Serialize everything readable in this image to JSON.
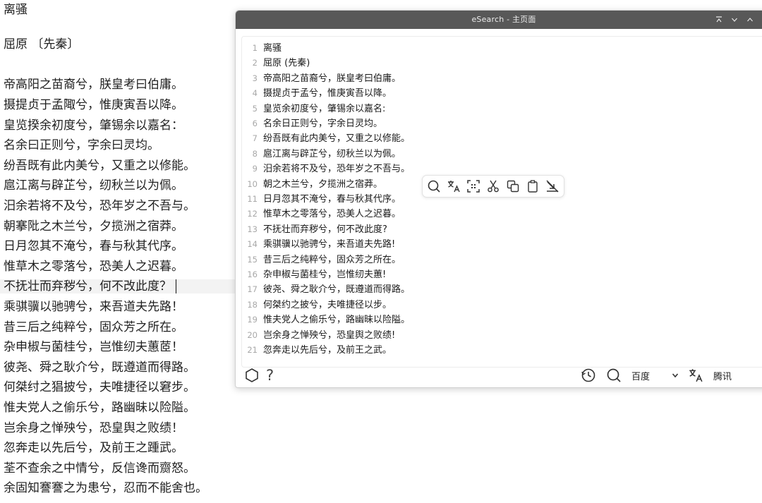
{
  "document": {
    "lines": [
      "离骚",
      "",
      "屈原 〔先秦〕",
      "",
      "帝高阳之苗裔兮，朕皇考曰伯庸。",
      "摄提贞于孟陬兮，惟庚寅吾以降。",
      "皇览揆余初度兮，肇锡余以嘉名：",
      "名余曰正则兮，字余曰灵均。",
      "纷吾既有此内美兮，又重之以修能。",
      "扈江离与辟芷兮，纫秋兰以为佩。",
      "汨余若将不及兮，恐年岁之不吾与。",
      "朝搴阰之木兰兮，夕揽洲之宿莽。",
      "日月忽其不淹兮，春与秋其代序。",
      "惟草木之零落兮，恐美人之迟暮。",
      "不抚壮而弃秽兮，何不改此度？",
      "乘骐骥以驰骋兮，来吾道夫先路！",
      "昔三后之纯粹兮，固众芳之所在。",
      "杂申椒与菌桂兮，岂惟纫夫蕙茝！",
      "彼尧、舜之耿介兮，既遵道而得路。",
      "何桀纣之猖披兮，夫唯捷径以窘步。",
      "惟夫党人之偷乐兮，路幽昧以险隘。",
      "岂余身之惮殃兮，恐皇舆之败绩！",
      "忽奔走以先后兮，及前王之踵武。",
      "荃不查余之中情兮，反信谗而齌怒。",
      "余固知謇謇之为患兮，忍而不能舍也。"
    ],
    "current_line_index": 14
  },
  "window": {
    "title": "eSearch - 主页面"
  },
  "editor": {
    "lines": [
      {
        "num": "1",
        "text": "离骚"
      },
      {
        "num": "2",
        "text": "屈原 (先秦)"
      },
      {
        "num": "3",
        "text": "帝高阳之苗裔兮，朕皇考曰伯庸。"
      },
      {
        "num": "4",
        "text": "摄提贞于孟兮，惟庚寅吾以降。"
      },
      {
        "num": "5",
        "text": "皇览余初度兮，肇锡余以嘉名:"
      },
      {
        "num": "6",
        "text": "名余日正则兮，字余日灵均。"
      },
      {
        "num": "7",
        "text": "纷吾既有此内美兮，又重之以修能。"
      },
      {
        "num": "8",
        "text": "扈江离与辟芷兮，纫秋兰以为佩。"
      },
      {
        "num": "9",
        "text": "汨余若将不及兮，恐年岁之不吾与。"
      },
      {
        "num": "10",
        "text": "朝之木兰兮，夕揽洲之宿莽。"
      },
      {
        "num": "11",
        "text": "日月忽其不淹兮，春与秋其代序。"
      },
      {
        "num": "12",
        "text": "惟草木之零落兮，恐美人之迟暮。"
      },
      {
        "num": "13",
        "text": "不抚壮而弃秽兮，何不改此度?"
      },
      {
        "num": "14",
        "text": "乘骐骥以驰骋兮，来吾道夫先路!"
      },
      {
        "num": "15",
        "text": "昔三后之纯粹兮，固众芳之所在。"
      },
      {
        "num": "16",
        "text": "杂申椒与菌桂兮，岂惟纫夫蕙!"
      },
      {
        "num": "17",
        "text": "彼尧、舜之耿介兮，既遵道而得路。"
      },
      {
        "num": "18",
        "text": "何桀约之披兮，夫唯捷径以步。"
      },
      {
        "num": "19",
        "text": "惟夫党人之偷乐兮，路幽昧以险隘。"
      },
      {
        "num": "20",
        "text": "岂余身之惮殃兮，恐皇舆之败绩!"
      },
      {
        "num": "21",
        "text": "忽奔走以先后兮，及前王之武。"
      }
    ]
  },
  "selection_toolbar": {
    "icons": [
      "search-icon",
      "translate-icon",
      "scan-icon",
      "cut-icon",
      "copy-icon",
      "paste-icon",
      "no-wrap-icon"
    ]
  },
  "bottom_bar": {
    "search_engine": "百度",
    "translate_engine": "腾讯"
  },
  "colors": {
    "titlebar": "#585858",
    "line_number": "#a8a8a8",
    "current_line": "#f3f3f3"
  }
}
